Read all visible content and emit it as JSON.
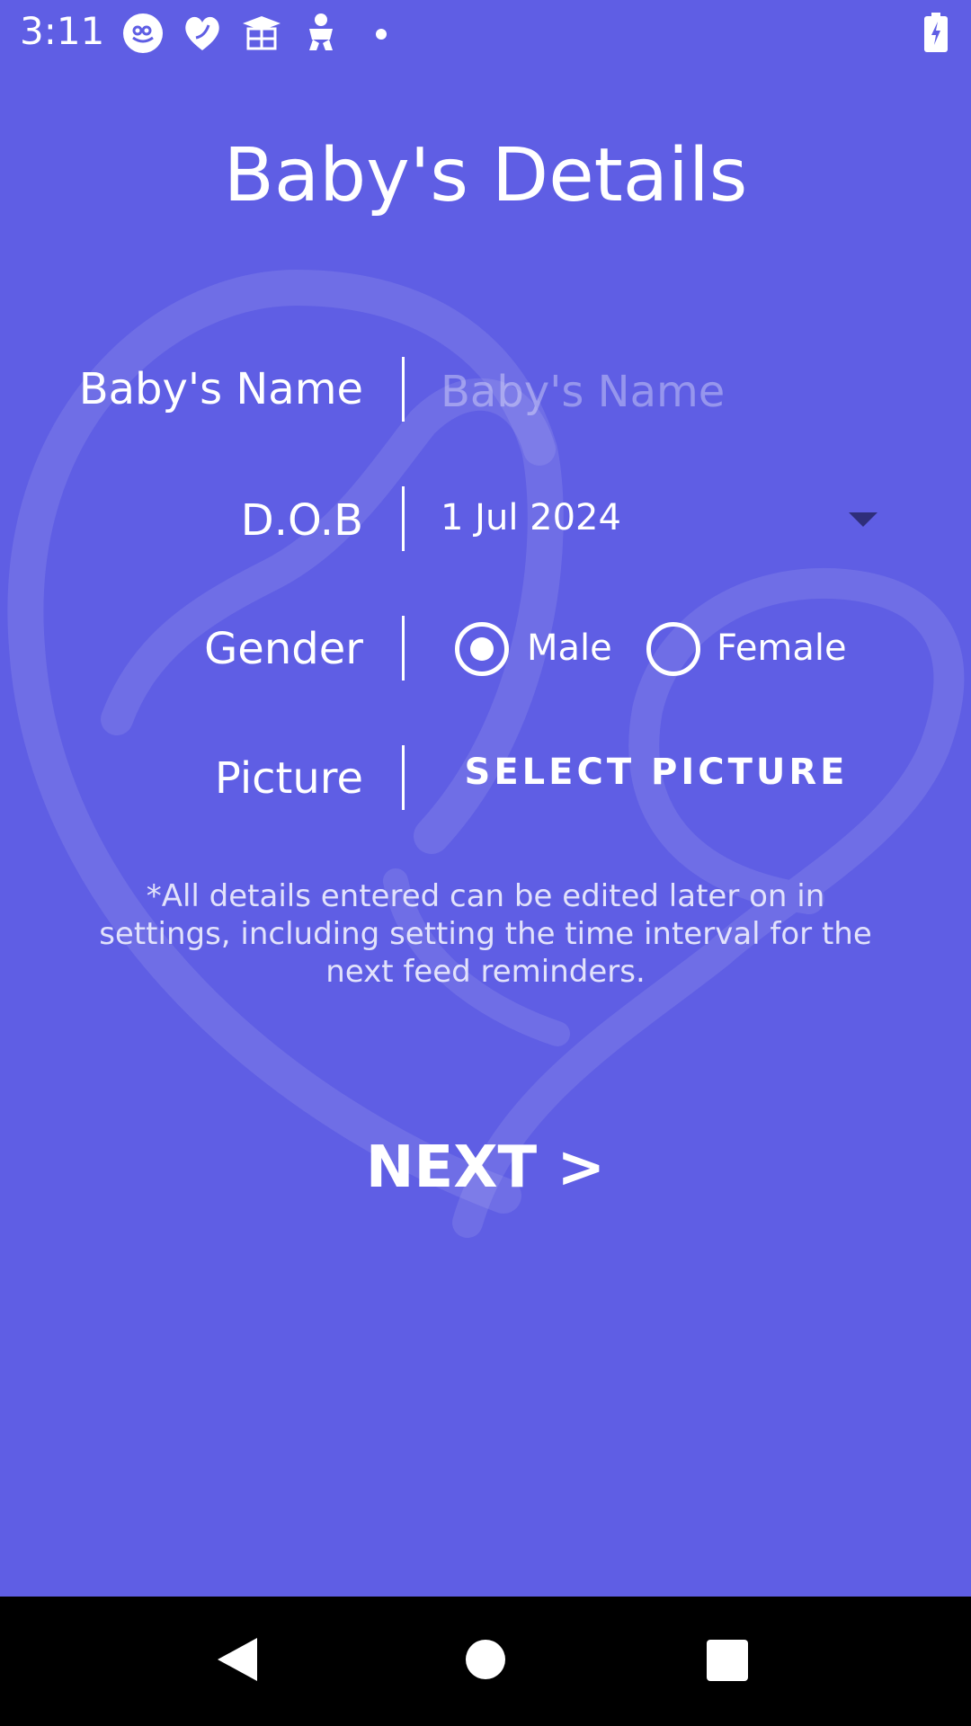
{
  "status_bar": {
    "time": "3:11",
    "icons": [
      "baby-face-icon",
      "heart-icon",
      "graduation-cap-icon",
      "baby-figure-icon",
      "dot-icon"
    ],
    "battery": "battery-charging-icon"
  },
  "page": {
    "title": "Baby's Details"
  },
  "form": {
    "name_label": "Baby's Name",
    "name_placeholder": "Baby's Name",
    "name_value": "",
    "dob_label": "D.O.B",
    "dob_value": "1 Jul 2024",
    "gender_label": "Gender",
    "gender_options": [
      {
        "label": "Male",
        "selected": true
      },
      {
        "label": "Female",
        "selected": false
      }
    ],
    "picture_label": "Picture",
    "select_picture_label": "SELECT PICTURE"
  },
  "note": "*All details entered can be edited later on in settings, including setting the time interval for the next feed reminders.",
  "next_label": "NEXT >",
  "colors": {
    "background": "#5f5ee4",
    "text": "#ffffff",
    "nav_bar": "#000000",
    "dropdown_arrow": "#2f2e7a"
  },
  "nav_bar": {
    "icons": [
      "back-icon",
      "home-icon",
      "recents-icon"
    ]
  }
}
